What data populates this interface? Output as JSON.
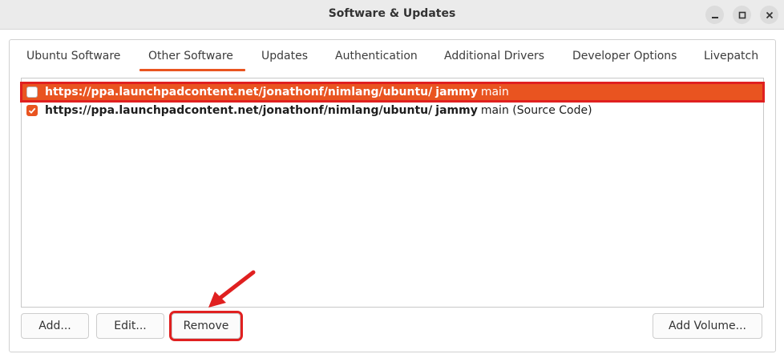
{
  "window": {
    "title": "Software & Updates",
    "controls": [
      "minimize-icon",
      "maximize-icon",
      "close-icon"
    ]
  },
  "tabs": [
    {
      "label": "Ubuntu Software",
      "active": false
    },
    {
      "label": "Other Software",
      "active": true
    },
    {
      "label": "Updates",
      "active": false
    },
    {
      "label": "Authentication",
      "active": false
    },
    {
      "label": "Additional Drivers",
      "active": false
    },
    {
      "label": "Developer Options",
      "active": false
    },
    {
      "label": "Livepatch",
      "active": false
    }
  ],
  "sources": [
    {
      "url": "https://ppa.launchpadcontent.net/jonathonf/nimlang/ubuntu/",
      "suite": "jammy",
      "component": "main",
      "checked": false,
      "selected": true
    },
    {
      "url": "https://ppa.launchpadcontent.net/jonathonf/nimlang/ubuntu/",
      "suite": "jammy",
      "component": "main (Source Code)",
      "checked": true,
      "selected": false
    }
  ],
  "buttons": {
    "add": "Add...",
    "edit": "Edit...",
    "remove": "Remove",
    "add_volume": "Add Volume..."
  },
  "colors": {
    "accent": "#e95420",
    "annotation": "#e02020"
  }
}
